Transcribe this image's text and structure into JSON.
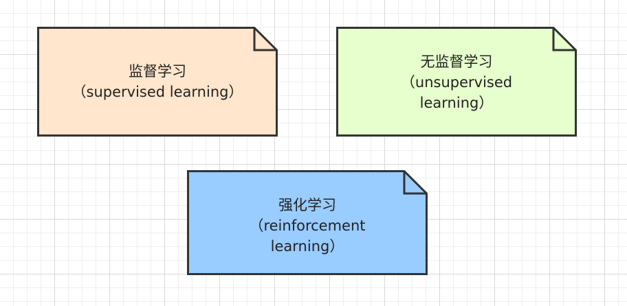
{
  "diagram": {
    "notes": [
      {
        "fill": "#ffe6cc",
        "lines": [
          "监督学习",
          "（supervised learning）"
        ]
      },
      {
        "fill": "#e6ffcc",
        "lines": [
          "无监督学习",
          "（unsupervised",
          "learning）"
        ]
      },
      {
        "fill": "#99ccff",
        "lines": [
          "强化学习",
          "（reinforcement",
          "learning）"
        ]
      }
    ]
  }
}
